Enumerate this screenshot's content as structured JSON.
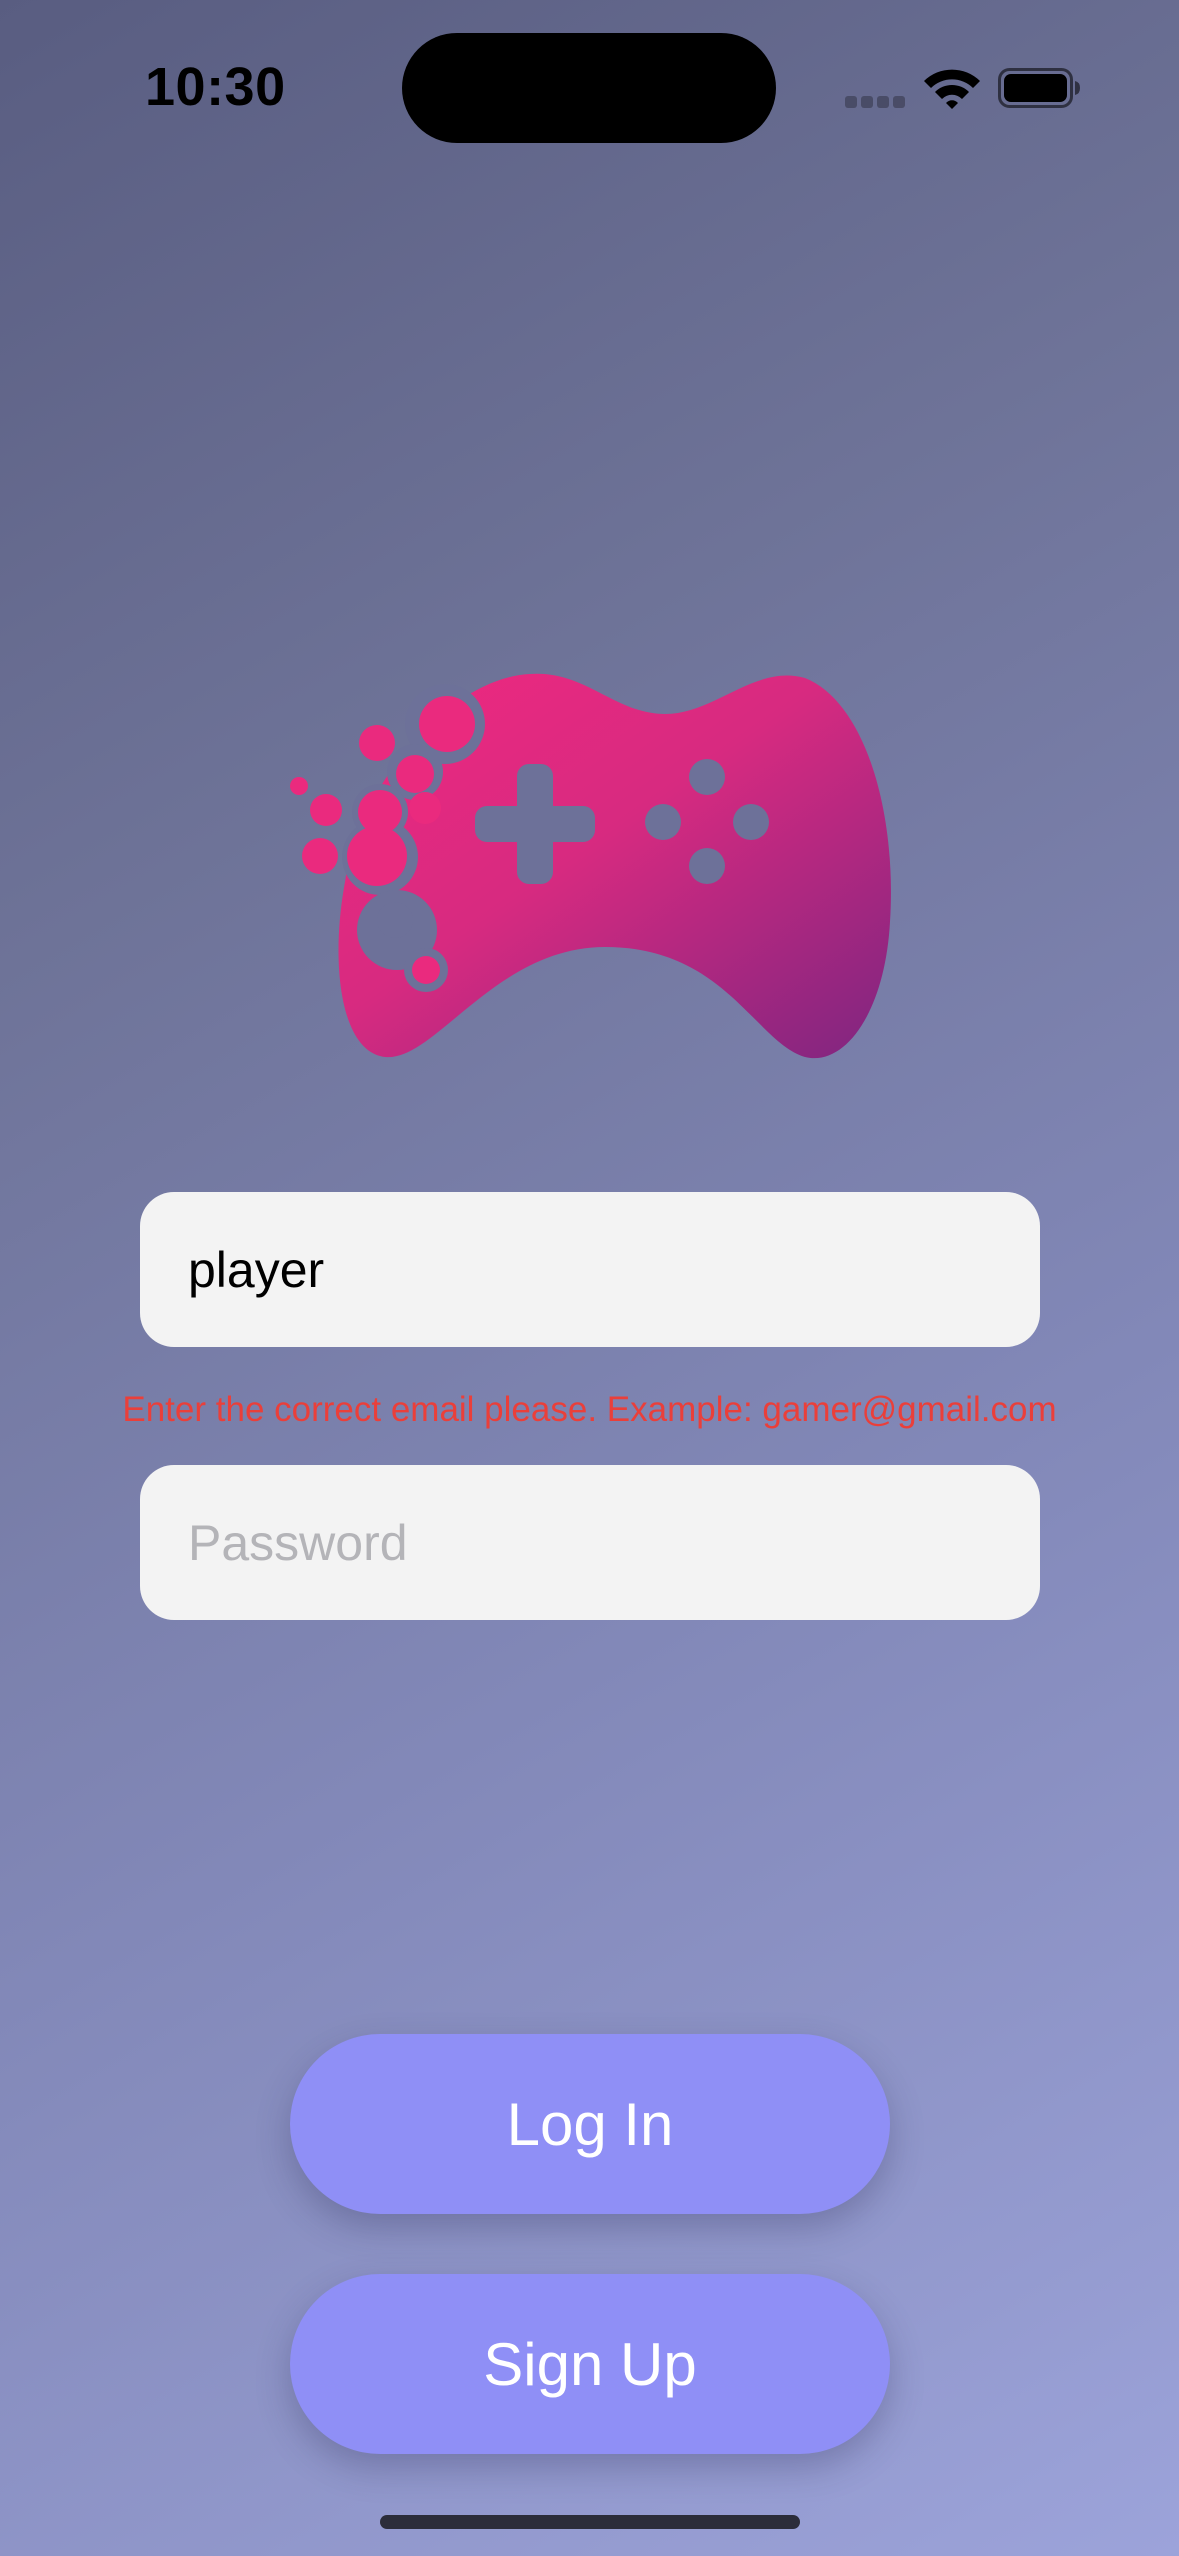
{
  "status_bar": {
    "time": "10:30"
  },
  "logo": {
    "icon": "gamepad-icon",
    "gradient_start": "#f0287f",
    "gradient_end": "#7e2580"
  },
  "login_form": {
    "email": {
      "value": "player",
      "placeholder": ""
    },
    "email_error": "Enter the correct email please. Example: gamer@gmail.com",
    "password": {
      "value": "",
      "placeholder": "Password"
    }
  },
  "actions": {
    "login_label": "Log In",
    "signup_label": "Sign Up"
  },
  "colors": {
    "button": "#8f8ff6",
    "error": "#ea3f3a",
    "field_background": "#f3f3f3"
  }
}
